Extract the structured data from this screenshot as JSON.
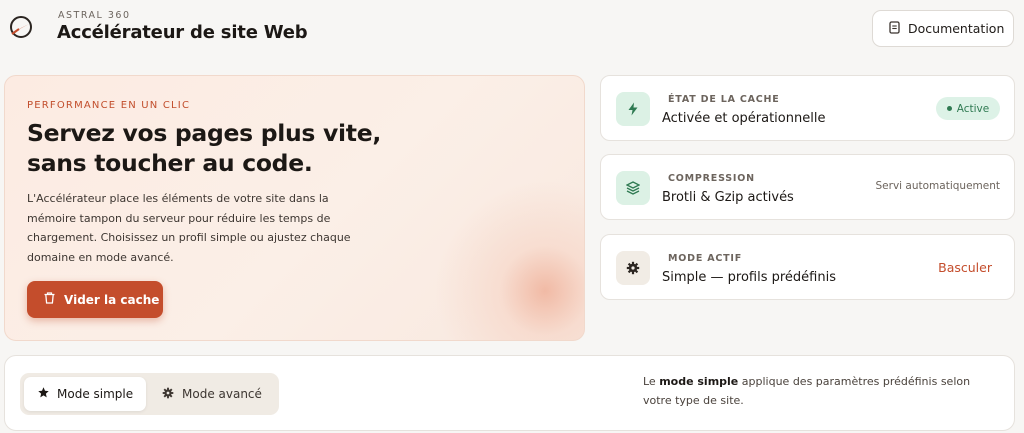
{
  "header": {
    "brand_kicker": "ASTRAL 360",
    "title": "Accélérateur de site Web",
    "doc_button_label": "Documentation",
    "logo_icon": "astral-logo-icon",
    "doc_icon": "document-icon"
  },
  "hero": {
    "kicker": "PERFORMANCE EN UN CLIC",
    "title": "Servez vos pages plus vite, sans toucher au code.",
    "description": "L'Accélérateur place les éléments de votre site dans la mémoire tampon du serveur pour réduire les temps de chargement. Choisissez un profil simple ou ajustez chaque domaine en mode avancé.",
    "clear_button_label": "Vider la cache",
    "clear_icon": "trash-icon"
  },
  "status_cards": [
    {
      "label": "ÉTAT DE LA CACHE",
      "value": "Activée et opérationnelle",
      "badge": "Active",
      "icon": "bolt-icon"
    },
    {
      "label": "COMPRESSION",
      "value": "Brotli & Gzip activés",
      "note": "Servi automatiquement",
      "icon": "layers-icon"
    },
    {
      "label": "MODE ACTIF",
      "value": "Simple — profils prédéfinis",
      "action": "Basculer",
      "icon": "gear-icon"
    }
  ],
  "mode_switch": {
    "simple_label": "Mode simple",
    "advanced_label": "Mode avancé",
    "simple_icon": "star-icon",
    "advanced_icon": "gear-icon",
    "help_prefix": "Le ",
    "help_bold": "mode simple",
    "help_suffix": " applique des paramètres prédéfinis selon votre type de site."
  },
  "colors": {
    "accent": "#c44d2c",
    "success": "#2f7a52",
    "success_bg": "#ddf2e7"
  }
}
